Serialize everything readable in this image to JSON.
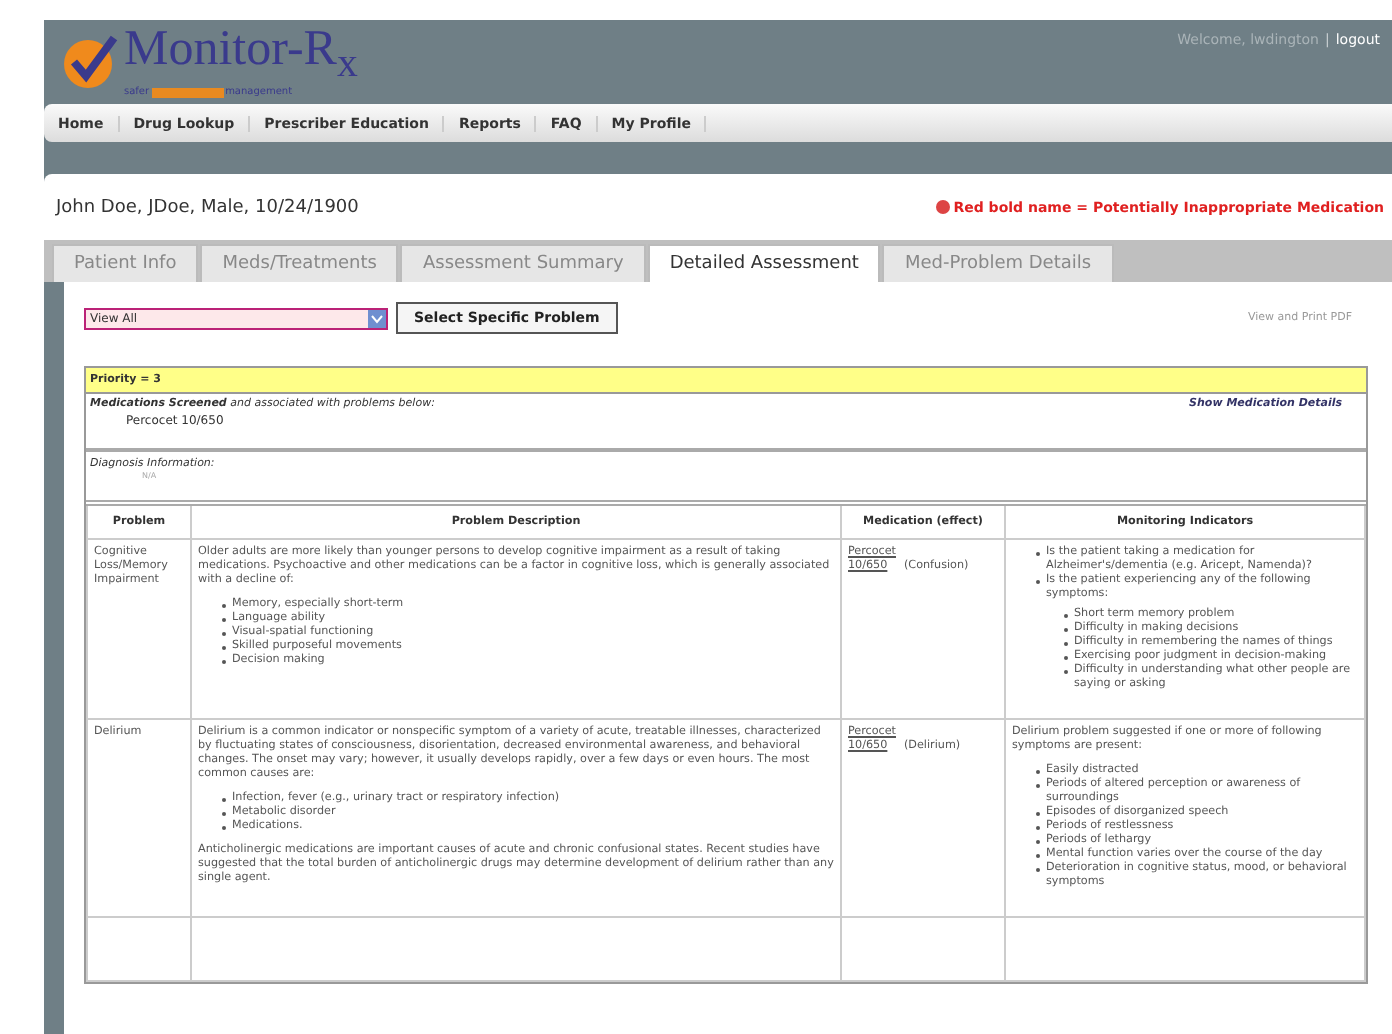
{
  "header": {
    "logo": "Monitor-R$_{x}$",
    "tagline_start": "safer",
    "tagline_end": "management",
    "welcome": "Welcome, lwdington",
    "separator": "|",
    "logout": "logout"
  },
  "nav": [
    "Home",
    "Drug Lookup",
    "Prescriber Education",
    "Reports",
    "FAQ",
    "My Profile"
  ],
  "patient": {
    "name": "John Doe, JDoe, Male, 10/24/1900",
    "legend": "Red bold name = Potentially Inappropriate Medication"
  },
  "tabs": [
    {
      "label": "Patient Info",
      "selected": false
    },
    {
      "label": "Meds/Treatments",
      "selected": false
    },
    {
      "label": "Assessment Summary",
      "selected": false
    },
    {
      "label": "Detailed Assessment",
      "selected": true
    },
    {
      "label": "Med-Problem Details",
      "selected": false
    }
  ],
  "toolbar": {
    "select_value": "View All",
    "button": "Select Specific Problem",
    "pdf_link": "View and Print PDF"
  },
  "priority": {
    "label": "Priority = 3",
    "screened": "**Medications Screened** and associated with problems below:",
    "medication": "Percocet 10/650",
    "details_link": "Show Medication Details",
    "diagnosis_label": "Diagnosis Information:",
    "diagnosis_value": "N/A"
  },
  "table": {
    "columns": [
      "Problem",
      "Problem Description",
      "Medication (effect)",
      "Monitoring Indicators"
    ],
    "rows": [
      {
        "problem": "Cognitive Loss/Memory Impairment",
        "description": [
          {
            "kind": "para",
            "text": "Older adults are more likely than younger persons to develop cognitive impairment as a result of taking medications. Psychoactive and other medications can be a factor in cognitive loss, which is generally associated with a decline of:"
          },
          {
            "kind": "list",
            "items": [
              {
                "text": "Memory, especially short-term"
              },
              {
                "text": "Language ability"
              },
              {
                "text": "Visual-spatial functioning"
              },
              {
                "text": "Skilled purposeful movements"
              },
              {
                "text": "Decision making"
              }
            ]
          }
        ],
        "med_link": "Percocet 10/650",
        "effect": "(Confusion)",
        "monitoring": [
          {
            "kind": "list",
            "items": [
              {
                "text": "Is the patient taking a medication for Alzheimer's/dementia (e.g. Aricept, Namenda)?"
              },
              {
                "text": "Is the patient experiencing any of the following symptoms:",
                "children": [
                  {
                    "text": "Short term memory problem"
                  },
                  {
                    "text": "Difficulty in making decisions"
                  },
                  {
                    "text": "Difficulty in remembering the names of things"
                  },
                  {
                    "text": "Exercising poor judgment in decision-making"
                  },
                  {
                    "text": "Difficulty in understanding what other people are saying or asking"
                  }
                ]
              }
            ]
          }
        ]
      },
      {
        "problem": "Delirium",
        "description": [
          {
            "kind": "para",
            "text": "Delirium is a common indicator or nonspecific symptom of a variety of acute, treatable illnesses, characterized by fluctuating states of consciousness, disorientation, decreased environmental awareness, and behavioral changes. The onset may vary; however, it usually develops rapidly, over a few days or even hours. The most common causes are:"
          },
          {
            "kind": "list",
            "items": [
              {
                "text": "Infection, fever (e.g., urinary tract or respiratory infection)"
              },
              {
                "text": "Metabolic disorder"
              },
              {
                "text": "Medications."
              }
            ]
          },
          {
            "kind": "para",
            "text": "Anticholinergic medications are important causes of acute and chronic confusional states. Recent studies have suggested that the total burden of anticholinergic drugs may determine development of delirium rather than any single agent."
          }
        ],
        "med_link": "Percocet 10/650",
        "effect": "(Delirium)",
        "monitoring": [
          {
            "kind": "para",
            "text": "Delirium problem suggested if one or more of following symptoms are present:"
          },
          {
            "kind": "list",
            "items": [
              {
                "text": "Easily distracted"
              },
              {
                "text": "Periods of altered perception or awareness of surroundings"
              },
              {
                "text": "Episodes of disorganized speech"
              },
              {
                "text": "Periods of restlessness"
              },
              {
                "text": "Periods of lethargy"
              },
              {
                "text": "Mental function varies over the course of the day"
              },
              {
                "text": "Deterioration in cognitive status, mood, or behavioral symptoms"
              }
            ]
          }
        ]
      }
    ]
  }
}
